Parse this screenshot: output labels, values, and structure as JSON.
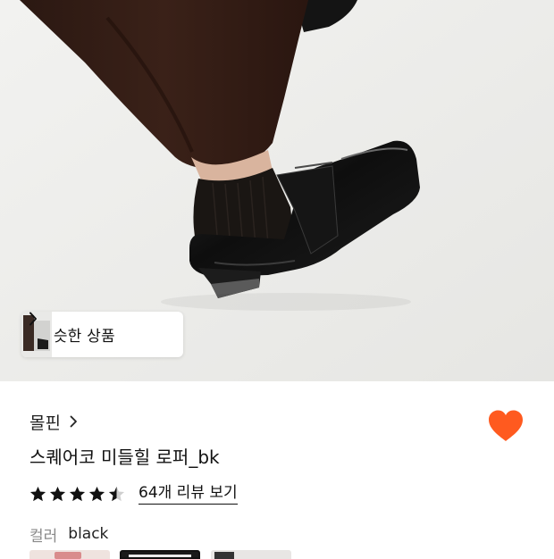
{
  "similar": {
    "label": "비슷한 상품"
  },
  "product": {
    "brand": "몰핀",
    "title": "스퀘어코 미들힐 로퍼_bk",
    "rating": 4.5,
    "rating_max": 5,
    "review_link": "64개 리뷰 보기",
    "wishlisted": true
  },
  "color_option": {
    "label": "컬러",
    "value": "black",
    "swatches": [
      {
        "name": "option-1",
        "selected": false
      },
      {
        "name": "option-2",
        "selected": true
      },
      {
        "name": "option-3",
        "selected": false
      }
    ]
  },
  "colors": {
    "heart": "#ff5a1f",
    "star": "#111111",
    "star_empty": "#cfcfcf"
  },
  "icons": {
    "brand": "chevron-right-icon",
    "similar": "chevron-right-icon",
    "wish": "heart-icon",
    "rating": "star-icon"
  }
}
